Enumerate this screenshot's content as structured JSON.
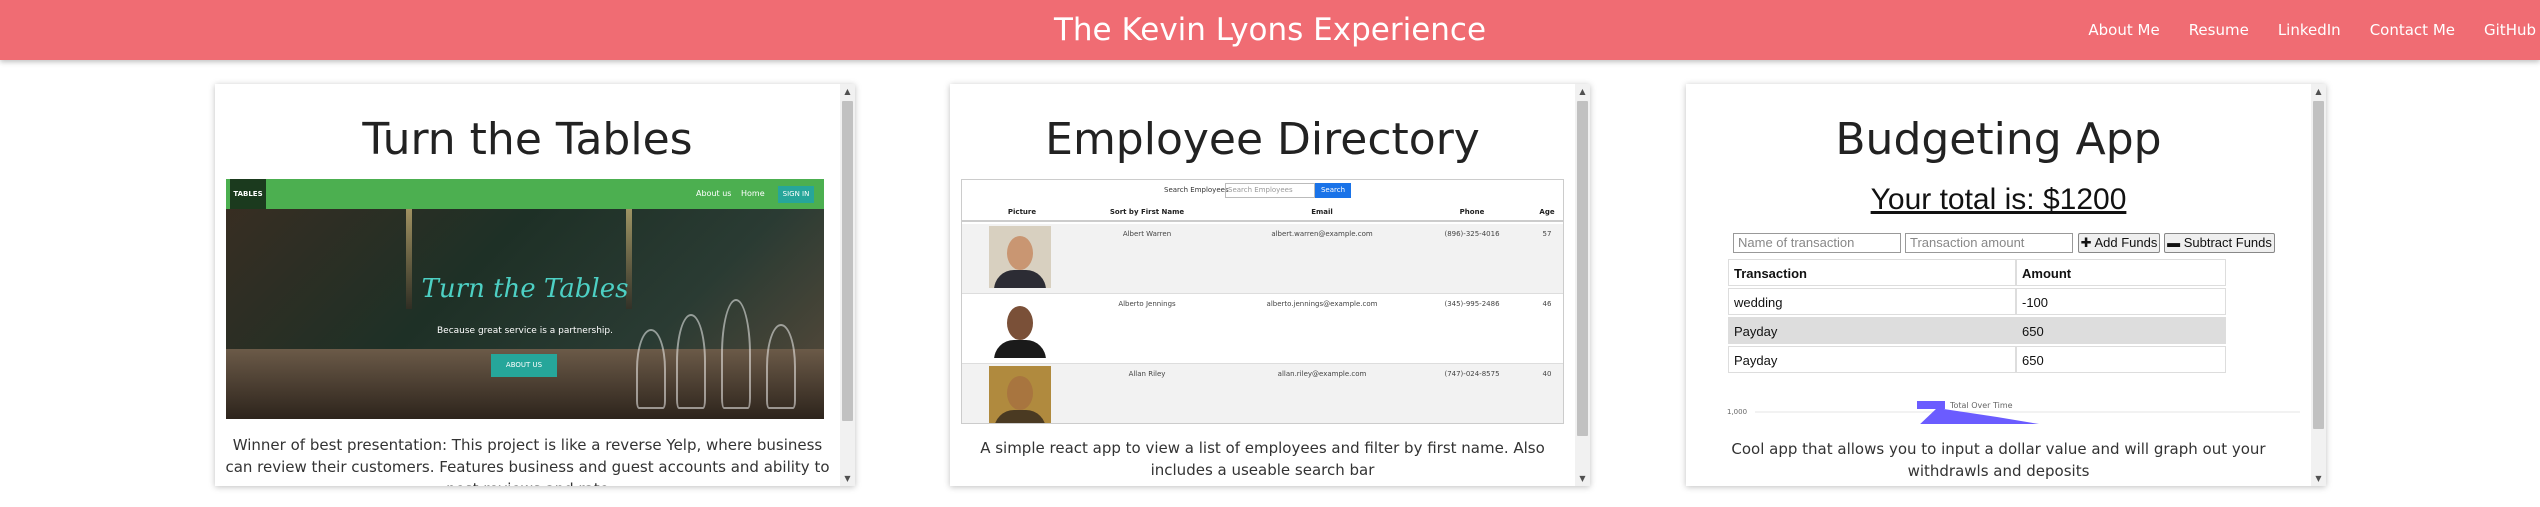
{
  "navbar": {
    "title": "The Kevin Lyons Experience",
    "links": [
      "About Me",
      "Resume",
      "LinkedIn",
      "Contact Me",
      "GitHub"
    ],
    "bg_color": "#f06c73"
  },
  "cards": [
    {
      "title": "Turn the Tables",
      "description": "Winner of best presentation: This project is like a reverse Yelp, where business can review their customers. Features business and guest accounts and ability to post reviews and rate",
      "preview": {
        "logo_text": "TABLES",
        "nav_items": [
          "About us",
          "Home"
        ],
        "signin": "SIGN IN",
        "headline": "Turn the Tables",
        "subtitle": "Because great service is a partnership.",
        "button": "ABOUT US"
      }
    },
    {
      "title": "Employee Directory",
      "description": "A simple react app to view a list of employees and filter by first name. Also includes a useable search bar",
      "preview": {
        "search_label": "Search Employees",
        "search_placeholder": "Search Employees",
        "search_button": "Search",
        "headers": [
          "Picture",
          "Sort by First Name",
          "Email",
          "Phone",
          "Age"
        ],
        "rows": [
          {
            "name": "Albert Warren",
            "email": "albert.warren@example.com",
            "phone": "(896)-325-4016",
            "age": "57"
          },
          {
            "name": "Alberto Jennings",
            "email": "alberto.jennings@example.com",
            "phone": "(345)-995-2486",
            "age": "46"
          },
          {
            "name": "Allan Riley",
            "email": "allan.riley@example.com",
            "phone": "(747)-024-8575",
            "age": "40"
          }
        ]
      }
    },
    {
      "title": "Budgeting App",
      "description": "Cool app that allows you to input a dollar value and will graph out your withdrawls and deposits",
      "preview": {
        "total": "Your total is: $1200",
        "name_placeholder": "Name of transaction",
        "amount_placeholder": "Transaction amount",
        "add_button": "Add Funds",
        "subtract_button": "Subtract Funds",
        "table_headers": [
          "Transaction",
          "Amount"
        ],
        "rows": [
          {
            "transaction": "wedding",
            "amount": "-100"
          },
          {
            "transaction": "Payday",
            "amount": "650"
          },
          {
            "transaction": "Payday",
            "amount": "650"
          }
        ],
        "chart_legend": "Total Over Time",
        "chart_tick": "1,000"
      }
    }
  ]
}
